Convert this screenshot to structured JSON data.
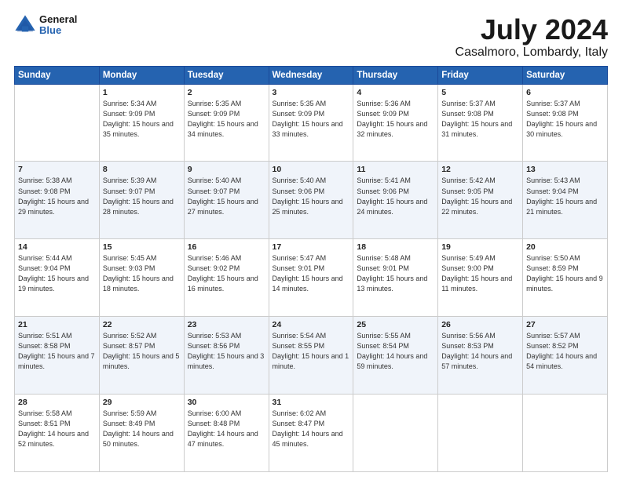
{
  "header": {
    "logo_general": "General",
    "logo_blue": "Blue",
    "title": "July 2024",
    "subtitle": "Casalmoro, Lombardy, Italy"
  },
  "days_of_week": [
    "Sunday",
    "Monday",
    "Tuesday",
    "Wednesday",
    "Thursday",
    "Friday",
    "Saturday"
  ],
  "weeks": [
    [
      {
        "day": "",
        "sunrise": "",
        "sunset": "",
        "daylight": ""
      },
      {
        "day": "1",
        "sunrise": "Sunrise: 5:34 AM",
        "sunset": "Sunset: 9:09 PM",
        "daylight": "Daylight: 15 hours and 35 minutes."
      },
      {
        "day": "2",
        "sunrise": "Sunrise: 5:35 AM",
        "sunset": "Sunset: 9:09 PM",
        "daylight": "Daylight: 15 hours and 34 minutes."
      },
      {
        "day": "3",
        "sunrise": "Sunrise: 5:35 AM",
        "sunset": "Sunset: 9:09 PM",
        "daylight": "Daylight: 15 hours and 33 minutes."
      },
      {
        "day": "4",
        "sunrise": "Sunrise: 5:36 AM",
        "sunset": "Sunset: 9:09 PM",
        "daylight": "Daylight: 15 hours and 32 minutes."
      },
      {
        "day": "5",
        "sunrise": "Sunrise: 5:37 AM",
        "sunset": "Sunset: 9:08 PM",
        "daylight": "Daylight: 15 hours and 31 minutes."
      },
      {
        "day": "6",
        "sunrise": "Sunrise: 5:37 AM",
        "sunset": "Sunset: 9:08 PM",
        "daylight": "Daylight: 15 hours and 30 minutes."
      }
    ],
    [
      {
        "day": "7",
        "sunrise": "Sunrise: 5:38 AM",
        "sunset": "Sunset: 9:08 PM",
        "daylight": "Daylight: 15 hours and 29 minutes."
      },
      {
        "day": "8",
        "sunrise": "Sunrise: 5:39 AM",
        "sunset": "Sunset: 9:07 PM",
        "daylight": "Daylight: 15 hours and 28 minutes."
      },
      {
        "day": "9",
        "sunrise": "Sunrise: 5:40 AM",
        "sunset": "Sunset: 9:07 PM",
        "daylight": "Daylight: 15 hours and 27 minutes."
      },
      {
        "day": "10",
        "sunrise": "Sunrise: 5:40 AM",
        "sunset": "Sunset: 9:06 PM",
        "daylight": "Daylight: 15 hours and 25 minutes."
      },
      {
        "day": "11",
        "sunrise": "Sunrise: 5:41 AM",
        "sunset": "Sunset: 9:06 PM",
        "daylight": "Daylight: 15 hours and 24 minutes."
      },
      {
        "day": "12",
        "sunrise": "Sunrise: 5:42 AM",
        "sunset": "Sunset: 9:05 PM",
        "daylight": "Daylight: 15 hours and 22 minutes."
      },
      {
        "day": "13",
        "sunrise": "Sunrise: 5:43 AM",
        "sunset": "Sunset: 9:04 PM",
        "daylight": "Daylight: 15 hours and 21 minutes."
      }
    ],
    [
      {
        "day": "14",
        "sunrise": "Sunrise: 5:44 AM",
        "sunset": "Sunset: 9:04 PM",
        "daylight": "Daylight: 15 hours and 19 minutes."
      },
      {
        "day": "15",
        "sunrise": "Sunrise: 5:45 AM",
        "sunset": "Sunset: 9:03 PM",
        "daylight": "Daylight: 15 hours and 18 minutes."
      },
      {
        "day": "16",
        "sunrise": "Sunrise: 5:46 AM",
        "sunset": "Sunset: 9:02 PM",
        "daylight": "Daylight: 15 hours and 16 minutes."
      },
      {
        "day": "17",
        "sunrise": "Sunrise: 5:47 AM",
        "sunset": "Sunset: 9:01 PM",
        "daylight": "Daylight: 15 hours and 14 minutes."
      },
      {
        "day": "18",
        "sunrise": "Sunrise: 5:48 AM",
        "sunset": "Sunset: 9:01 PM",
        "daylight": "Daylight: 15 hours and 13 minutes."
      },
      {
        "day": "19",
        "sunrise": "Sunrise: 5:49 AM",
        "sunset": "Sunset: 9:00 PM",
        "daylight": "Daylight: 15 hours and 11 minutes."
      },
      {
        "day": "20",
        "sunrise": "Sunrise: 5:50 AM",
        "sunset": "Sunset: 8:59 PM",
        "daylight": "Daylight: 15 hours and 9 minutes."
      }
    ],
    [
      {
        "day": "21",
        "sunrise": "Sunrise: 5:51 AM",
        "sunset": "Sunset: 8:58 PM",
        "daylight": "Daylight: 15 hours and 7 minutes."
      },
      {
        "day": "22",
        "sunrise": "Sunrise: 5:52 AM",
        "sunset": "Sunset: 8:57 PM",
        "daylight": "Daylight: 15 hours and 5 minutes."
      },
      {
        "day": "23",
        "sunrise": "Sunrise: 5:53 AM",
        "sunset": "Sunset: 8:56 PM",
        "daylight": "Daylight: 15 hours and 3 minutes."
      },
      {
        "day": "24",
        "sunrise": "Sunrise: 5:54 AM",
        "sunset": "Sunset: 8:55 PM",
        "daylight": "Daylight: 15 hours and 1 minute."
      },
      {
        "day": "25",
        "sunrise": "Sunrise: 5:55 AM",
        "sunset": "Sunset: 8:54 PM",
        "daylight": "Daylight: 14 hours and 59 minutes."
      },
      {
        "day": "26",
        "sunrise": "Sunrise: 5:56 AM",
        "sunset": "Sunset: 8:53 PM",
        "daylight": "Daylight: 14 hours and 57 minutes."
      },
      {
        "day": "27",
        "sunrise": "Sunrise: 5:57 AM",
        "sunset": "Sunset: 8:52 PM",
        "daylight": "Daylight: 14 hours and 54 minutes."
      }
    ],
    [
      {
        "day": "28",
        "sunrise": "Sunrise: 5:58 AM",
        "sunset": "Sunset: 8:51 PM",
        "daylight": "Daylight: 14 hours and 52 minutes."
      },
      {
        "day": "29",
        "sunrise": "Sunrise: 5:59 AM",
        "sunset": "Sunset: 8:49 PM",
        "daylight": "Daylight: 14 hours and 50 minutes."
      },
      {
        "day": "30",
        "sunrise": "Sunrise: 6:00 AM",
        "sunset": "Sunset: 8:48 PM",
        "daylight": "Daylight: 14 hours and 47 minutes."
      },
      {
        "day": "31",
        "sunrise": "Sunrise: 6:02 AM",
        "sunset": "Sunset: 8:47 PM",
        "daylight": "Daylight: 14 hours and 45 minutes."
      },
      {
        "day": "",
        "sunrise": "",
        "sunset": "",
        "daylight": ""
      },
      {
        "day": "",
        "sunrise": "",
        "sunset": "",
        "daylight": ""
      },
      {
        "day": "",
        "sunrise": "",
        "sunset": "",
        "daylight": ""
      }
    ]
  ]
}
